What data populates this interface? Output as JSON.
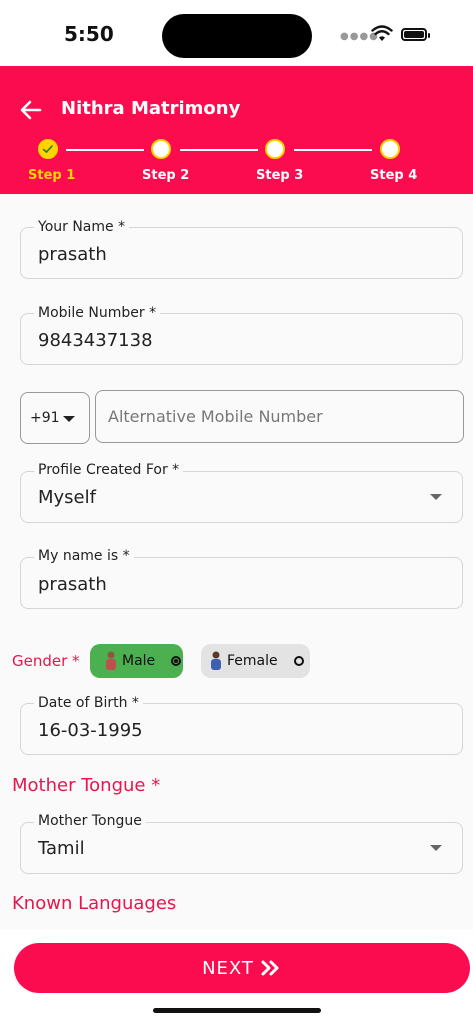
{
  "status": {
    "time": "5:50"
  },
  "header": {
    "title": "Nithra Matrimony"
  },
  "steps": [
    {
      "label": "Step 1",
      "done": true
    },
    {
      "label": "Step 2",
      "done": false
    },
    {
      "label": "Step 3",
      "done": false
    },
    {
      "label": "Step 4",
      "done": false
    }
  ],
  "form": {
    "name": {
      "label": "Your Name *",
      "value": "prasath"
    },
    "mobile": {
      "label": "Mobile Number *",
      "value": "9843437138"
    },
    "alt_mobile": {
      "country_code": "+91",
      "placeholder": "Alternative Mobile Number"
    },
    "profile_for": {
      "label": "Profile Created For *",
      "value": "Myself"
    },
    "my_name": {
      "label": "My name is *",
      "value": "prasath"
    },
    "gender": {
      "label": "Gender *",
      "male": "Male",
      "female": "Female",
      "selected": "Male"
    },
    "dob": {
      "label": "Date of Birth *",
      "value": "16-03-1995"
    },
    "mother_tongue_section": "Mother Tongue *",
    "mother_tongue": {
      "label": "Mother Tongue",
      "value": "Tamil"
    },
    "known_languages_section": "Known Languages"
  },
  "actions": {
    "next": "NEXT"
  },
  "colors": {
    "primary": "#fa0c4f",
    "step_active": "#ffd400",
    "male_chip": "#4caf50"
  }
}
